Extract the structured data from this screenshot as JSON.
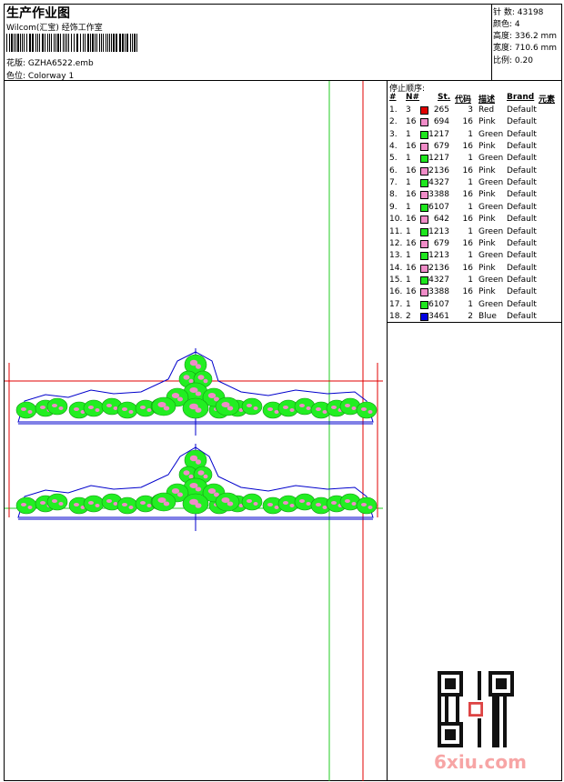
{
  "header": {
    "title": "生产作业图",
    "company": "Wilcom(汇宝) 经饰工作室",
    "design_label": "花版: ",
    "design_file": "GZHA6522.emb",
    "colorway_label": "色位: ",
    "colorway": "Colorway 1"
  },
  "meta": [
    {
      "label": "针 数: ",
      "value": "43198"
    },
    {
      "label": "颜色: ",
      "value": "4"
    },
    {
      "label": "高度: ",
      "value": "336.2 mm"
    },
    {
      "label": "宽度: ",
      "value": "710.6 mm"
    },
    {
      "label": "比例: ",
      "value": "0.20"
    }
  ],
  "stop_sequence": {
    "title": "停止顺序:",
    "headers": [
      "#",
      "N#",
      "St.",
      "代码",
      "描述",
      "Brand",
      "元素"
    ],
    "rows": [
      {
        "idx": "1.",
        "n": "3",
        "color": "#e00000",
        "st": "265",
        "code": "3",
        "desc": "Red",
        "brand": "Default"
      },
      {
        "idx": "2.",
        "n": "16",
        "color": "#f08cc8",
        "st": "694",
        "code": "16",
        "desc": "Pink",
        "brand": "Default"
      },
      {
        "idx": "3.",
        "n": "1",
        "color": "#1ee61e",
        "st": "1217",
        "code": "1",
        "desc": "Green",
        "brand": "Default"
      },
      {
        "idx": "4.",
        "n": "16",
        "color": "#f08cc8",
        "st": "679",
        "code": "16",
        "desc": "Pink",
        "brand": "Default"
      },
      {
        "idx": "5.",
        "n": "1",
        "color": "#1ee61e",
        "st": "1217",
        "code": "1",
        "desc": "Green",
        "brand": "Default"
      },
      {
        "idx": "6.",
        "n": "16",
        "color": "#f08cc8",
        "st": "2136",
        "code": "16",
        "desc": "Pink",
        "brand": "Default"
      },
      {
        "idx": "7.",
        "n": "1",
        "color": "#1ee61e",
        "st": "4327",
        "code": "1",
        "desc": "Green",
        "brand": "Default"
      },
      {
        "idx": "8.",
        "n": "16",
        "color": "#f08cc8",
        "st": "3388",
        "code": "16",
        "desc": "Pink",
        "brand": "Default"
      },
      {
        "idx": "9.",
        "n": "1",
        "color": "#1ee61e",
        "st": "6107",
        "code": "1",
        "desc": "Green",
        "brand": "Default"
      },
      {
        "idx": "10.",
        "n": "16",
        "color": "#f08cc8",
        "st": "642",
        "code": "16",
        "desc": "Pink",
        "brand": "Default"
      },
      {
        "idx": "11.",
        "n": "1",
        "color": "#1ee61e",
        "st": "1213",
        "code": "1",
        "desc": "Green",
        "brand": "Default"
      },
      {
        "idx": "12.",
        "n": "16",
        "color": "#f08cc8",
        "st": "679",
        "code": "16",
        "desc": "Pink",
        "brand": "Default"
      },
      {
        "idx": "13.",
        "n": "1",
        "color": "#1ee61e",
        "st": "1213",
        "code": "1",
        "desc": "Green",
        "brand": "Default"
      },
      {
        "idx": "14.",
        "n": "16",
        "color": "#f08cc8",
        "st": "2136",
        "code": "16",
        "desc": "Pink",
        "brand": "Default"
      },
      {
        "idx": "15.",
        "n": "1",
        "color": "#1ee61e",
        "st": "4327",
        "code": "1",
        "desc": "Green",
        "brand": "Default"
      },
      {
        "idx": "16.",
        "n": "16",
        "color": "#f08cc8",
        "st": "3388",
        "code": "16",
        "desc": "Pink",
        "brand": "Default"
      },
      {
        "idx": "17.",
        "n": "1",
        "color": "#1ee61e",
        "st": "6107",
        "code": "1",
        "desc": "Green",
        "brand": "Default"
      },
      {
        "idx": "18.",
        "n": "2",
        "color": "#0000e0",
        "st": "3461",
        "code": "2",
        "desc": "Blue",
        "brand": "Default"
      }
    ]
  },
  "colors": {
    "guide_red": "#e00000",
    "guide_green": "#22cc22",
    "outline_blue": "#0000cc",
    "leaf_green": "#22ee22",
    "petal_pink": "#f08cc8",
    "watermark": "#f7a5a5"
  },
  "watermark": "6xiu.com",
  "qr_icon": "qr-code-icon"
}
